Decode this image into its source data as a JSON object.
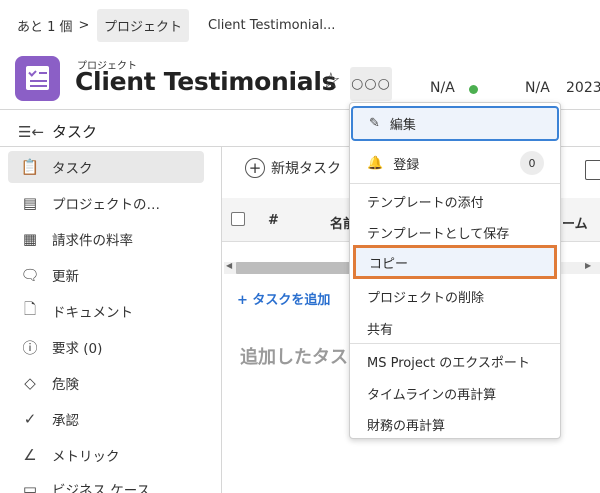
{
  "breadcrumb": {
    "back": "あと 1 個",
    "sep": ">",
    "level1": "プロジェクト",
    "current": "Client Testimonial..."
  },
  "header": {
    "subtitle": "プロジェクト",
    "title": "Client Testimonials",
    "more_label": "○○○",
    "status1": "N/A",
    "status2": "N/A",
    "date_partial": "2023"
  },
  "task_bar": {
    "label": "タスク"
  },
  "sidebar": {
    "items": [
      {
        "label": "タスク",
        "icon": "clipboard-check-icon"
      },
      {
        "label": "プロジェクトの…",
        "icon": "document-icon"
      },
      {
        "label": "請求件の料率",
        "icon": "rate-sheet-icon"
      },
      {
        "label": "更新",
        "icon": "speech-bubble-icon"
      },
      {
        "label": "ドキュメント",
        "icon": "file-icon"
      },
      {
        "label": "要求 (0)",
        "icon": "request-bubble-icon"
      },
      {
        "label": "危険",
        "icon": "risk-diamond-icon"
      },
      {
        "label": "承認",
        "icon": "approval-check-icon"
      },
      {
        "label": "メトリック",
        "icon": "chart-line-icon"
      },
      {
        "label": "ビジネス ケース",
        "icon": "briefcase-icon"
      }
    ]
  },
  "main": {
    "new_task": "新規タスク",
    "col_hash": "#",
    "col_name": "名前",
    "col_right": "ーム",
    "add_task": "+ タスクを追加",
    "empty_text": "追加したタスクはここに表示されま"
  },
  "menu": {
    "edit": "編集",
    "subscribe": "登録",
    "subscribe_count": "0",
    "attach_template": "テンプレートの添付",
    "save_template": "テンプレートとして保存",
    "copy": "コピー",
    "delete_project": "プロジェクトの削除",
    "share": "共有",
    "export_ms": "MS Project のエクスポート",
    "recalc_timeline": "タイムラインの再計算",
    "recalc_finance": "財務の再計算"
  },
  "colors": {
    "accent": "#3b82d6",
    "highlight": "#e07b39",
    "project_icon": "#8b5fc6",
    "status_green": "#4caf50",
    "link": "#2a6fcf"
  }
}
